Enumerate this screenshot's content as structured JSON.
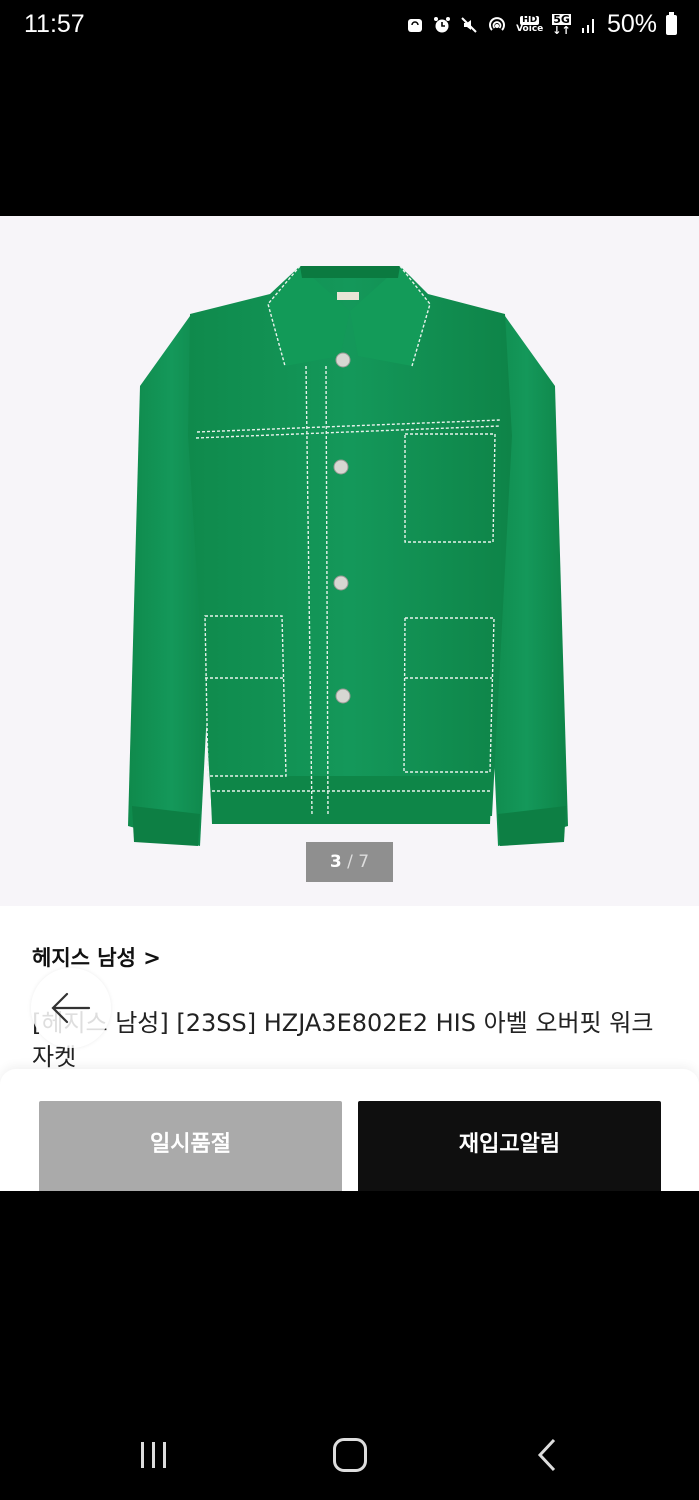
{
  "status_bar": {
    "time": "11:57",
    "battery": "50%",
    "icons": [
      "sync-icon",
      "alarm-icon",
      "mute-icon",
      "hotspot-icon",
      "hd-voice-icon",
      "5g-icon",
      "signal-icon",
      "battery-icon"
    ],
    "hd_label": "HD",
    "net_label": "5G"
  },
  "product": {
    "image_counter_current": "3",
    "image_counter_sep": " / ",
    "image_counter_total": "7",
    "brand_link": "헤지스 남성 >",
    "title": "[헤지스 남성] [23SS] HZJA3E802E2 HIS 아벨 오버핏 워크자켓",
    "jacket_color": "#129453",
    "stitch_color": "#e8f3ec",
    "collar_label": "HIS"
  },
  "actions": {
    "soldout_label": "일시품절",
    "restock_label": "재입고알림"
  },
  "nav_icons": [
    "back-arrow-icon",
    "recents-icon",
    "home-icon",
    "back-chevron-icon"
  ]
}
